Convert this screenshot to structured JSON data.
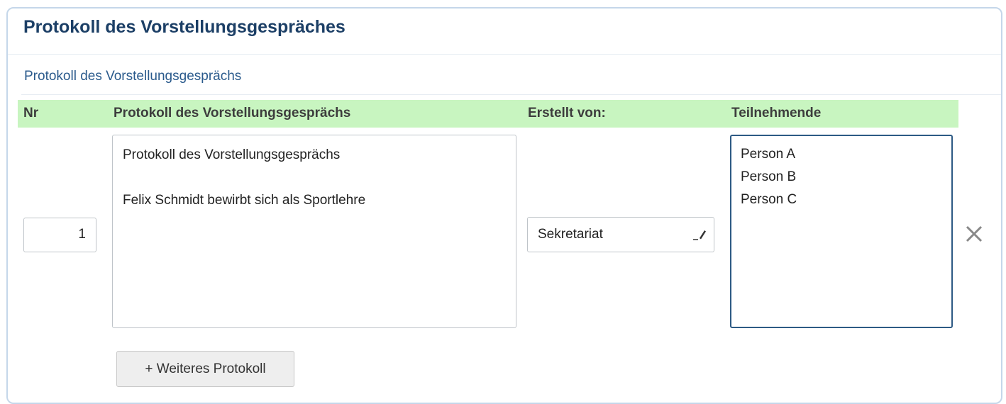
{
  "panel": {
    "title": "Protokoll des Vorstellungsgespräches"
  },
  "section": {
    "title": "Protokoll des Vorstellungsgesprächs"
  },
  "table": {
    "headers": {
      "nr": "Nr",
      "protocol": "Protokoll des Vorstellungsgesprächs",
      "created_by": "Erstellt von:",
      "participants": "Teilnehmende"
    },
    "rows": [
      {
        "nr": "1",
        "protocol": "Protokoll des Vorstellungsgesprächs\n\nFelix Schmidt bewirbt sich als Sportlehre",
        "created_by": "Sekretariat",
        "participants": "Person A\nPerson B\nPerson C"
      }
    ]
  },
  "actions": {
    "add_protocol_label": "+ Weiteres Protokoll"
  },
  "icons": {
    "edit": "pencil-icon",
    "remove": "close-icon"
  },
  "colors": {
    "header_bar": "#c8f5c0",
    "title": "#1c3f66",
    "section_title": "#2a5a8c",
    "active_border": "#2d5a84"
  }
}
